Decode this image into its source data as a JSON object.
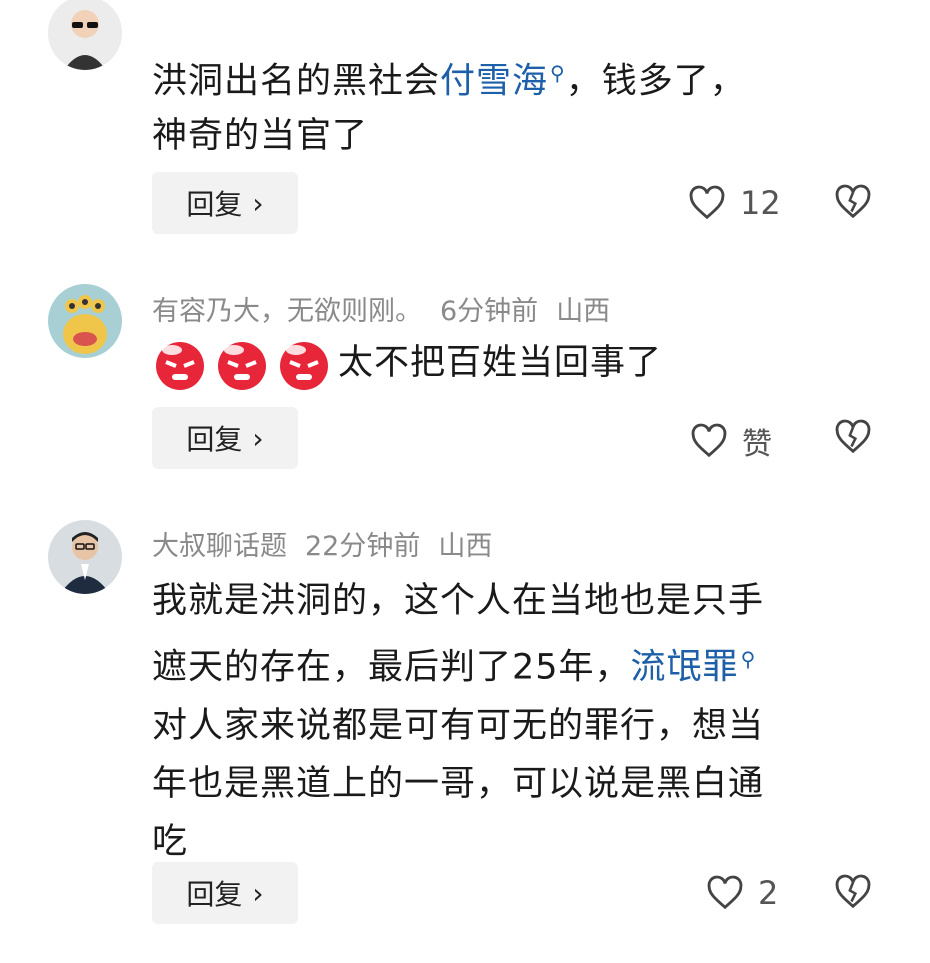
{
  "comments": [
    {
      "text_before": "洪洞出名的黑社会",
      "link": "付雪海",
      "text_after_line1": "，钱多了，",
      "text_line2": "神奇的当官了",
      "reply_label": "回复",
      "like_count": "12"
    },
    {
      "username": "有容乃大，无欲则刚。",
      "time": "6分钟前",
      "location": "山西",
      "text": "太不把百姓当回事了",
      "reply_label": "回复",
      "like_label": "赞"
    },
    {
      "username": "大叔聊话题",
      "time": "22分钟前",
      "location": "山西",
      "text_line1": "我就是洪洞的，这个人在当地也是只手",
      "text_line2_before": "遮天的存在，最后判了25年，",
      "link": "流氓罪",
      "text_line3": "对人家来说都是可有可无的罪行，想当",
      "text_line4": "年也是黑道上的一哥，可以说是黑白通",
      "text_line5": "吃",
      "reply_label": "回复",
      "like_count": "2"
    }
  ]
}
